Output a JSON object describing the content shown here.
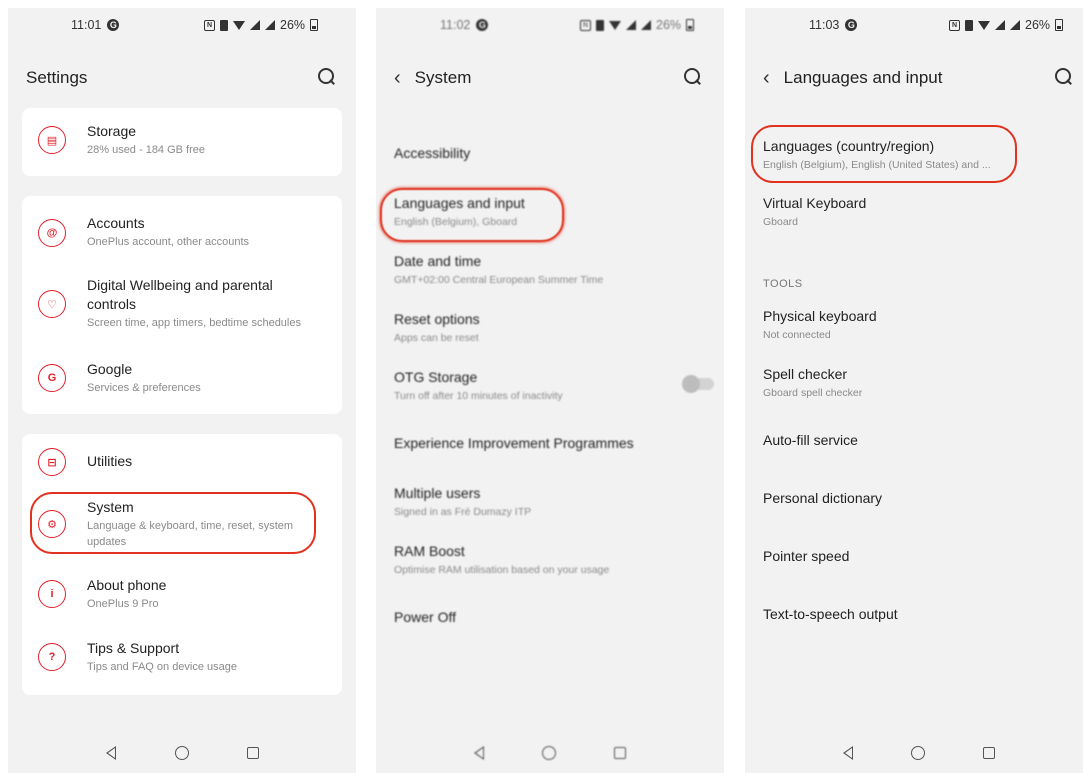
{
  "screen1": {
    "time": "11:01",
    "battery": "26%",
    "title": "Settings",
    "storage": {
      "title": "Storage",
      "subtitle": "28% used - 184 GB free"
    },
    "accounts": {
      "title": "Accounts",
      "subtitle": "OnePlus account, other accounts"
    },
    "wellbeing": {
      "title": "Digital Wellbeing and parental controls",
      "subtitle": "Screen time, app timers, bedtime schedules"
    },
    "google": {
      "title": "Google",
      "subtitle": "Services & preferences"
    },
    "utilities": {
      "title": "Utilities"
    },
    "system": {
      "title": "System",
      "subtitle": "Language & keyboard, time, reset, system updates"
    },
    "about": {
      "title": "About phone",
      "subtitle": "OnePlus 9 Pro"
    },
    "tips": {
      "title": "Tips & Support",
      "subtitle": "Tips and FAQ on device usage"
    }
  },
  "screen2": {
    "time": "11:02",
    "battery": "26%",
    "title": "System",
    "items": [
      {
        "title": "Accessibility",
        "subtitle": ""
      },
      {
        "title": "Languages and input",
        "subtitle": "English (Belgium), Gboard"
      },
      {
        "title": "Date and time",
        "subtitle": "GMT+02:00 Central European Summer Time"
      },
      {
        "title": "Reset options",
        "subtitle": "Apps can be reset"
      },
      {
        "title": "OTG Storage",
        "subtitle": "Turn off after 10 minutes of inactivity"
      },
      {
        "title": "Experience Improvement Programmes",
        "subtitle": ""
      },
      {
        "title": "Multiple users",
        "subtitle": "Signed in as Fré Dumazy ITP"
      },
      {
        "title": "RAM Boost",
        "subtitle": "Optimise RAM utilisation based on your usage"
      },
      {
        "title": "Power Off",
        "subtitle": ""
      }
    ]
  },
  "screen3": {
    "time": "11:03",
    "battery": "26%",
    "title": "Languages and input",
    "languages": {
      "title": "Languages (country/region)",
      "subtitle": "English (Belgium), English (United States) and ..."
    },
    "keyboard": {
      "title": "Virtual Keyboard",
      "subtitle": "Gboard"
    },
    "tools_header": "TOOLS",
    "physical": {
      "title": "Physical keyboard",
      "subtitle": "Not connected"
    },
    "spell": {
      "title": "Spell checker",
      "subtitle": "Gboard spell checker"
    },
    "autofill": {
      "title": "Auto-fill service"
    },
    "dictionary": {
      "title": "Personal dictionary"
    },
    "pointer": {
      "title": "Pointer speed"
    },
    "tts": {
      "title": "Text-to-speech output"
    }
  },
  "colors": {
    "accent": "#e2202a",
    "highlight": "#e0321e",
    "background": "#f2f2f2"
  }
}
